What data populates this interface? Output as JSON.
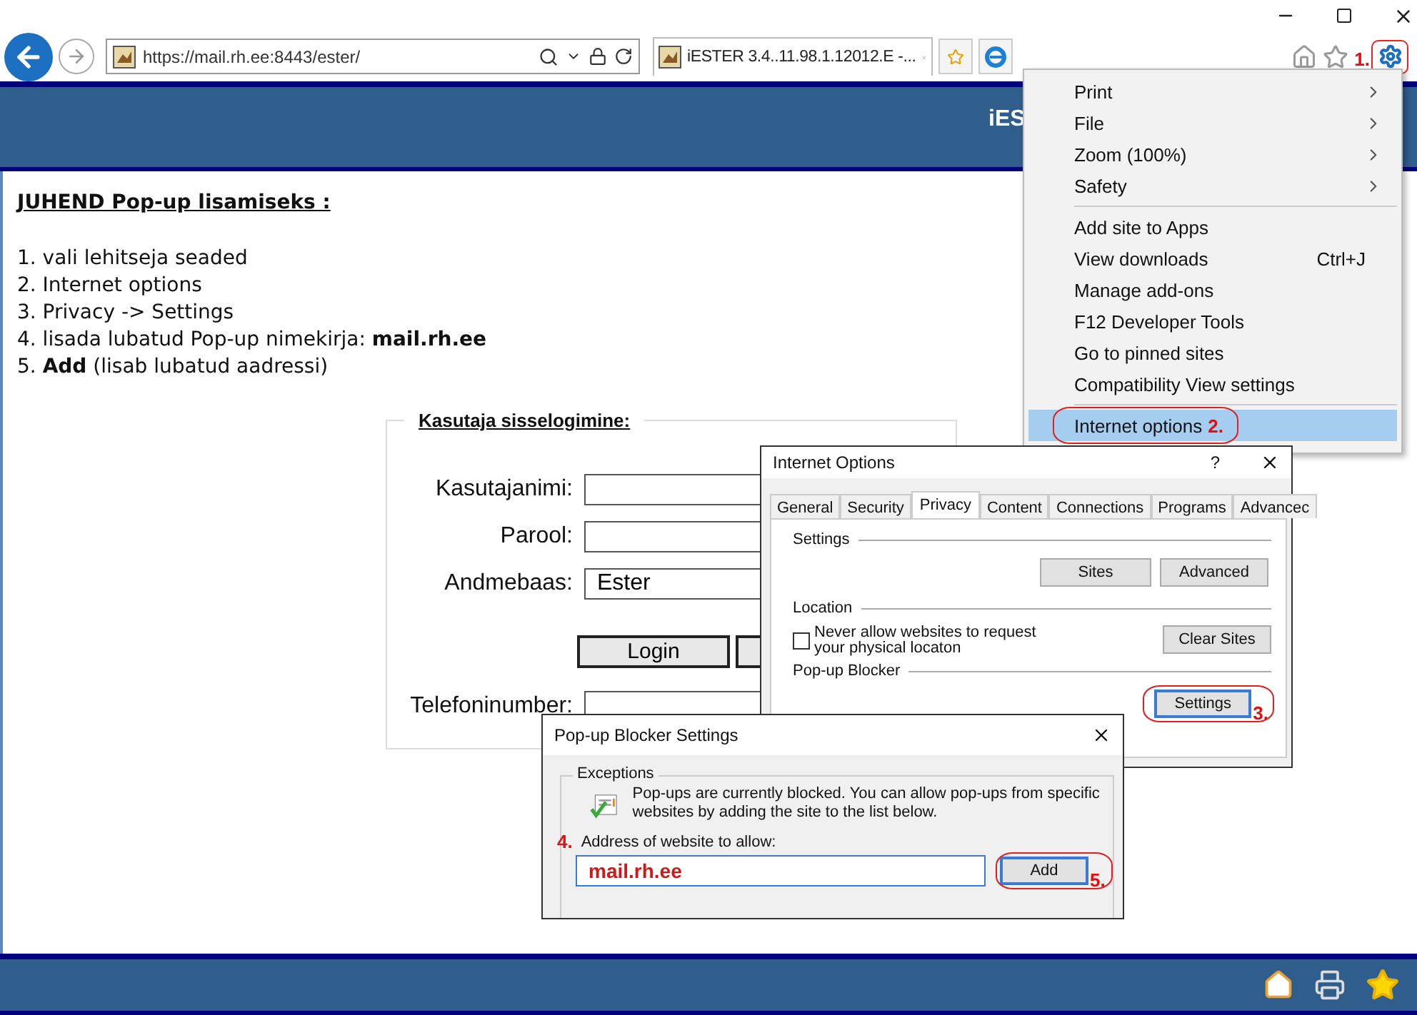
{
  "browser": {
    "address": "https://mail.rh.ee:8443/ester/",
    "tab_title": "iESTER 3.4..11.98.1.12012.E -...",
    "settings_annotation": "1."
  },
  "page": {
    "header_title": "iES",
    "guide_title": "JUHEND Pop-up lisamiseks :",
    "steps": [
      "1. vali lehitseja seaded",
      "2. Internet options",
      "3. Privacy -> Settings",
      "4. lisada lubatud Pop-up nimekirja:  **mail.rh.ee**",
      "5. **Add** (lisab lubatud aadressi)"
    ],
    "login": {
      "legend": "Kasutaja sisselogimine:",
      "fields": [
        {
          "label": "Kasutajanimi:"
        },
        {
          "label": "Parool:"
        },
        {
          "label": "Andmebaas:",
          "value": "Ester"
        }
      ],
      "login_button": "Login",
      "phone_label": "Telefoninumber:"
    }
  },
  "tools_menu": {
    "groups": [
      {
        "items": [
          {
            "label": "Print",
            "submenu": true,
            "selected": false
          },
          {
            "label": "File",
            "submenu": true,
            "selected": false
          },
          {
            "label": "Zoom (100%)",
            "submenu": true,
            "selected": false
          },
          {
            "label": "Safety",
            "submenu": true,
            "selected": false
          }
        ]
      },
      {
        "items": [
          {
            "label": "Add site to Apps",
            "submenu": false,
            "selected": false
          },
          {
            "label": "View downloads",
            "shortcut": "Ctrl+J",
            "submenu": false,
            "selected": false
          },
          {
            "label": "Manage add-ons",
            "submenu": false,
            "selected": false
          },
          {
            "label": "F12 Developer Tools",
            "submenu": false,
            "selected": false
          },
          {
            "label": "Go to pinned sites",
            "submenu": false,
            "selected": false
          },
          {
            "label": "Compatibility View settings",
            "submenu": false,
            "selected": false
          }
        ]
      },
      {
        "items": [
          {
            "label": "Internet options",
            "submenu": false,
            "selected": true,
            "annotation": "2."
          }
        ]
      }
    ]
  },
  "internet_options": {
    "title": "Internet Options",
    "help": "?",
    "tabs": [
      {
        "label": "General",
        "selected": false
      },
      {
        "label": "Security",
        "selected": false
      },
      {
        "label": "Privacy",
        "selected": true
      },
      {
        "label": "Content",
        "selected": false
      },
      {
        "label": "Connections",
        "selected": false
      },
      {
        "label": "Programs",
        "selected": false
      },
      {
        "label": "Advancec",
        "selected": false
      }
    ],
    "settings_label": "Settings",
    "settings_buttons": [
      "Sites",
      "Advanced"
    ],
    "location_label": "Location",
    "location_checkbox": {
      "label": "Never allow websites to request your physical locaton",
      "checked": false
    },
    "clear_sites_button": "Clear Sites",
    "popup_label": "Pop-up Blocker",
    "popup_settings_button": "Settings",
    "popup_annotation": "3."
  },
  "popup_blocker": {
    "title": "Pop-up Blocker Settings",
    "group": "Exceptions",
    "info": "Pop-ups are currently blocked.  You can allow pop-ups from specific websites by adding the site to the list below.",
    "address_annotation": "4.",
    "address_label": "Address of website to allow:",
    "address_value": "mail.rh.ee",
    "add_button": "Add",
    "add_annotation": "5."
  }
}
